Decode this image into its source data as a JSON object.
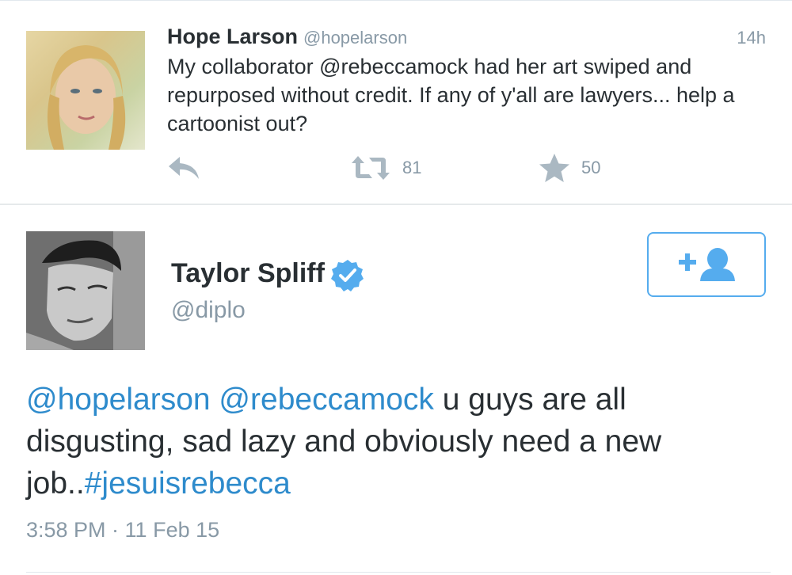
{
  "tweet1": {
    "name": "Hope Larson",
    "handle": "@hopelarson",
    "time": "14h",
    "text": "My collaborator @rebeccamock had her art swiped and repurposed without credit. If any of y'all are lawyers... help a cartoonist out?",
    "retweet_count": "81",
    "favorite_count": "50"
  },
  "tweet2": {
    "name": "Taylor Spliff",
    "handle": "@diplo",
    "text_parts": {
      "mention1": "@hopelarson",
      "space1": " ",
      "mention2": "@rebeccamock",
      "body": " u guys are all disgusting, sad lazy and obviously need a new job..",
      "hashtag": "#jesuisrebecca"
    },
    "timestamp": "3:58 PM · 11 Feb 15"
  },
  "icons": {
    "reply": "reply-icon",
    "retweet": "retweet-icon",
    "favorite": "star-icon",
    "verified": "verified-badge-icon",
    "follow": "add-user-icon"
  },
  "colors": {
    "accent": "#55acee",
    "link": "#2e8bcc",
    "muted": "#8899a6",
    "text": "#292f33",
    "icon_gray": "#aab8c2"
  }
}
